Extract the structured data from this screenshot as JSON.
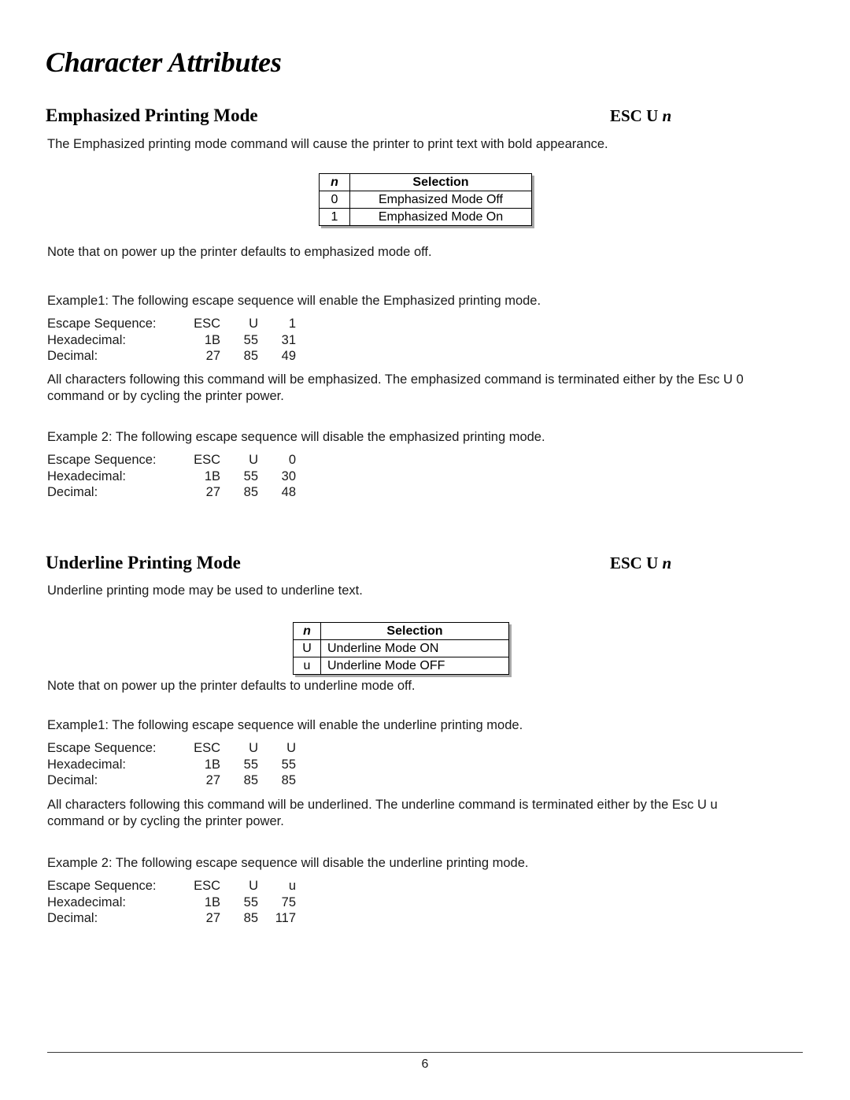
{
  "document": {
    "title": "Character Attributes",
    "page_number": "6"
  },
  "sections": [
    {
      "heading": "Emphasized Printing Mode",
      "command_prefix": "ESC U ",
      "command_var": "n",
      "intro": "The Emphasized printing mode command will cause the printer to print text with bold appearance.",
      "table": {
        "headers": {
          "n": "n",
          "selection": "Selection"
        },
        "rows": [
          {
            "n": "0",
            "selection": "Emphasized Mode Off"
          },
          {
            "n": "1",
            "selection": "Emphasized Mode On"
          }
        ]
      },
      "note": "Note that on power up the printer defaults to emphasized mode off.",
      "example1_intro": "Example1: The following escape sequence will enable the Emphasized printing mode.",
      "example1": {
        "row1_label": "Escape Sequence:",
        "row1_v1": "ESC",
        "row1_v2": "U",
        "row1_v3": "1",
        "row2_label": "Hexadecimal:",
        "row2_v1": "1B",
        "row2_v2": "55",
        "row2_v3": "31",
        "row3_label": "Decimal:",
        "row3_v1": "27",
        "row3_v2": "85",
        "row3_v3": "49"
      },
      "between_text": "All characters following this command will be emphasized. The emphasized command is terminated either by the Esc U 0 command or by cycling the printer power.",
      "example2_intro": "Example 2: The following escape sequence will disable the emphasized printing mode.",
      "example2": {
        "row1_label": "Escape Sequence:",
        "row1_v1": "ESC",
        "row1_v2": "U",
        "row1_v3": "0",
        "row2_label": "Hexadecimal:",
        "row2_v1": "1B",
        "row2_v2": "55",
        "row2_v3": "30",
        "row3_label": "Decimal:",
        "row3_v1": "27",
        "row3_v2": "85",
        "row3_v3": "48"
      }
    },
    {
      "heading": "Underline Printing Mode",
      "command_prefix": "ESC U ",
      "command_var": "n",
      "intro": "Underline printing mode may be used to underline text.",
      "table": {
        "headers": {
          "n": "n",
          "selection": "Selection"
        },
        "rows": [
          {
            "n": "U",
            "selection": "Underline Mode ON"
          },
          {
            "n": "u",
            "selection": "Underline Mode OFF"
          }
        ]
      },
      "note": "Note that on power up the printer defaults to underline mode off.",
      "example1_intro": "Example1: The following escape sequence will enable the underline printing mode.",
      "example1": {
        "row1_label": "Escape Sequence:",
        "row1_v1": "ESC",
        "row1_v2": "U",
        "row1_v3": "U",
        "row2_label": "Hexadecimal:",
        "row2_v1": "1B",
        "row2_v2": "55",
        "row2_v3": "55",
        "row3_label": "Decimal:",
        "row3_v1": "27",
        "row3_v2": "85",
        "row3_v3": "85"
      },
      "between_text": "All characters following this command will be underlined. The underline command is terminated either by the Esc U u command or by cycling the printer power.",
      "example2_intro": "Example 2: The following escape sequence will disable the underline printing mode.",
      "example2": {
        "row1_label": "Escape Sequence:",
        "row1_v1": "ESC",
        "row1_v2": "U",
        "row1_v3": "u",
        "row2_label": "Hexadecimal:",
        "row2_v1": "1B",
        "row2_v2": "55",
        "row2_v3": "75",
        "row3_label": "Decimal:",
        "row3_v1": "27",
        "row3_v2": "85",
        "row3_v3": "117"
      }
    }
  ]
}
